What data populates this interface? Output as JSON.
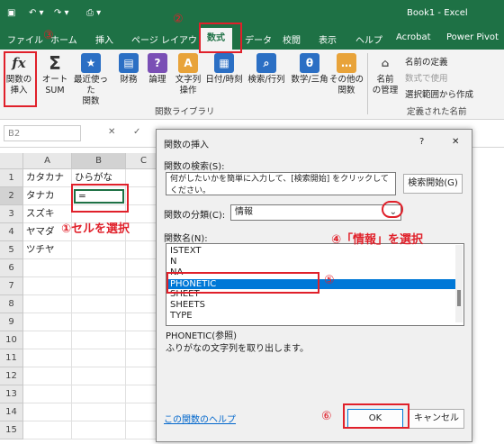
{
  "window": {
    "app_name": "Book1  -  Excel"
  },
  "ribbon_tabs": [
    "ファイル",
    "ホーム",
    "挿入",
    "ページ レイアウト",
    "数式",
    "データ",
    "校閲",
    "表示",
    "ヘルプ",
    "Acrobat",
    "Power Pivot"
  ],
  "ribbon": {
    "insert_function": "関数の\n挿入",
    "autosum": "オート\nSUM",
    "recent": "最近使った\n関数",
    "financial": "財務",
    "logical": "論理",
    "text": "文字列\n操作",
    "datetime": "日付/時刻",
    "lookup": "検索/行列",
    "math": "数学/三角",
    "other": "その他の\n関数",
    "group_library": "関数ライブラリ",
    "name_manager": "名前\nの管理",
    "define_name": "名前の定義",
    "use_in_formula": "数式で使用",
    "create_from_selection": "選択範囲から作成",
    "group_names": "定義された名前"
  },
  "formula_bar": {
    "name_box": "B2",
    "cancel": "✕",
    "enter": "✓"
  },
  "grid": {
    "columns": [
      "A",
      "B",
      "C"
    ],
    "rows": [
      "1",
      "2",
      "3",
      "4",
      "5",
      "6",
      "7",
      "8",
      "9",
      "10",
      "11",
      "12",
      "13",
      "14",
      "15"
    ],
    "col_a": [
      "カタカナ",
      "タナカ",
      "スズキ",
      "ヤマダ",
      "ツチヤ"
    ],
    "col_b": [
      "ひらがな",
      "="
    ]
  },
  "dialog": {
    "title": "関数の挿入",
    "help": "?",
    "close": "✕",
    "search_label": "関数の検索(S):",
    "search_placeholder": "何がしたいかを簡単に入力して、[検索開始] をクリックしてください。",
    "search_button": "検索開始(G)",
    "category_label": "関数の分類(C):",
    "category_value": "情報",
    "func_label": "関数名(N):",
    "functions": [
      "ISTEXT",
      "N",
      "NA",
      "PHONETIC",
      "SHEET",
      "SHEETS",
      "TYPE"
    ],
    "selected_function": "PHONETIC",
    "signature": "PHONETIC(参照)",
    "description": "ふりがなの文字列を取り出します。",
    "help_link": "この関数のヘルプ",
    "ok": "OK",
    "cancel": "キャンセル"
  },
  "annotations": {
    "n1": "①セルを選択",
    "n2": "②",
    "n3": "③",
    "n4": "④「情報」を選択",
    "n5": "⑤",
    "n6": "⑥"
  },
  "colors": {
    "excel_green": "#1e7145",
    "annotation_red": "#e0202a",
    "selection_blue": "#0078d7"
  }
}
